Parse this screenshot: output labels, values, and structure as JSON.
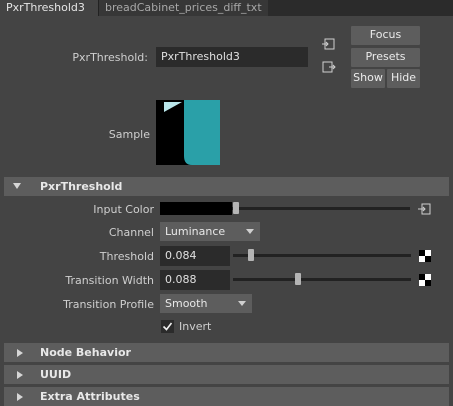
{
  "tabs": [
    {
      "label": "PxrThreshold3",
      "active": true
    },
    {
      "label": "breadCabinet_prices_diff_txt",
      "active": false
    }
  ],
  "header": {
    "node_label": "PxrThreshold:",
    "node_name": "PxrThreshold3",
    "focus_label": "Focus",
    "presets_label": "Presets",
    "show_label": "Show",
    "hide_label": "Hide"
  },
  "sample": {
    "label": "Sample",
    "colors": {
      "background": "#000000",
      "teal": "#2aa0a8",
      "light": "#b9e6ea"
    }
  },
  "sections": {
    "main": {
      "title": "PxrThreshold",
      "expanded": true
    },
    "collapsed": [
      {
        "title": "Node Behavior"
      },
      {
        "title": "UUID"
      },
      {
        "title": "Extra Attributes"
      }
    ]
  },
  "attributes": {
    "input_color": {
      "label": "Input Color",
      "color": "#000000"
    },
    "channel": {
      "label": "Channel",
      "value": "Luminance"
    },
    "threshold": {
      "label": "Threshold",
      "value": "0.084"
    },
    "transition_width": {
      "label": "Transition Width",
      "value": "0.088"
    },
    "transition_profile": {
      "label": "Transition Profile",
      "value": "Smooth"
    },
    "invert": {
      "label": "Invert",
      "checked": true
    }
  }
}
